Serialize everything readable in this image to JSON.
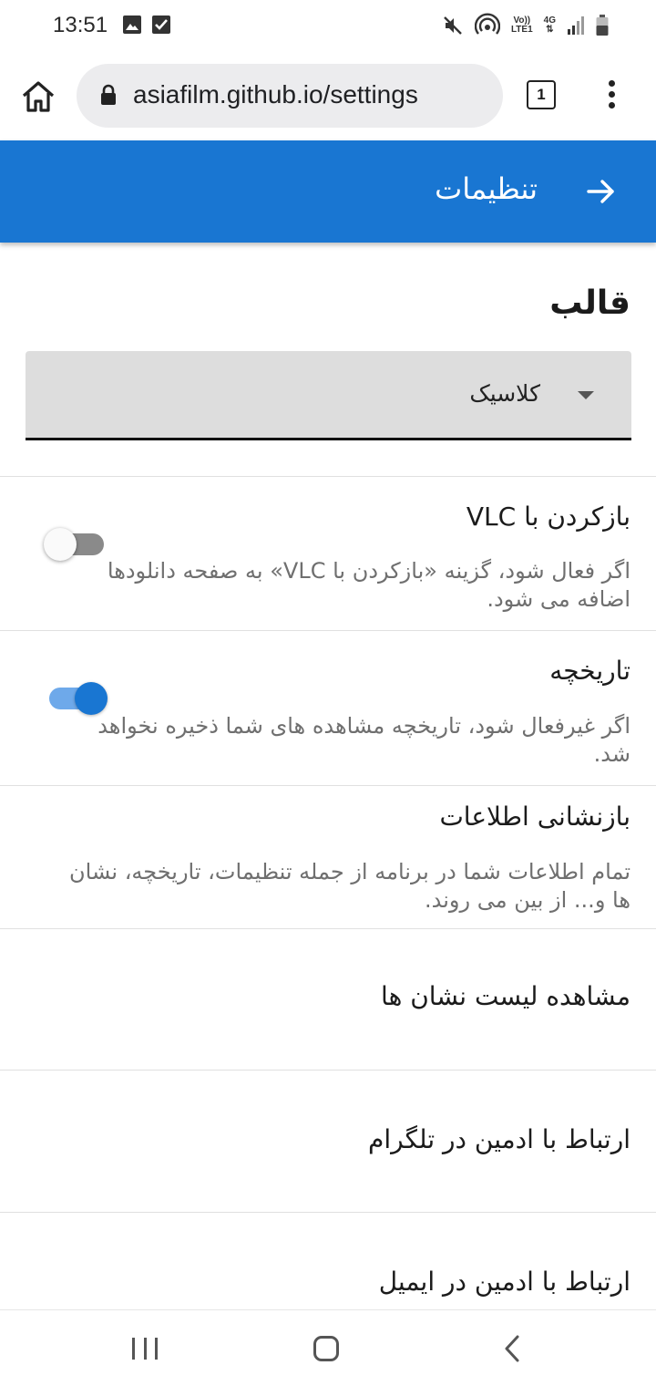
{
  "status_bar": {
    "time": "13:51",
    "volte_top": "Vo))",
    "volte_bottom": "LTE1",
    "network": "4G",
    "icons": [
      "gallery-icon",
      "check-icon",
      "mute-icon",
      "hotspot-icon",
      "volte-icon",
      "network-4g-icon",
      "signal-icon",
      "battery-icon"
    ]
  },
  "browser": {
    "url": "asiafilm.github.io/settings",
    "tab_count": "1",
    "icons": [
      "home-icon",
      "lock-icon",
      "tabs-icon",
      "more-vert-icon"
    ]
  },
  "app_bar": {
    "title": "تنظیمات",
    "background": "#1976d2",
    "icons": [
      "arrow-forward-icon"
    ]
  },
  "theme": {
    "title": "قالب",
    "selected": "کلاسیک"
  },
  "settings": {
    "vlc": {
      "title": "بازکردن با VLC",
      "description": "اگر فعال شود، گزینه «بازکردن با VLC» به صفحه دانلودها اضافه می شود.",
      "enabled": false
    },
    "history": {
      "title": "تاریخچه",
      "description": "اگر غیرفعال شود، تاریخچه مشاهده های شما ذخیره نخواهد شد.",
      "enabled": true
    },
    "reset": {
      "title": "بازنشانی اطلاعات",
      "description": "تمام اطلاعات شما در برنامه از جمله تنظیمات، تاریخچه، نشان ها و... از بین می روند."
    },
    "bookmarks": {
      "title": "مشاهده لیست نشان ها"
    },
    "telegram": {
      "title": "ارتباط با ادمین در تلگرام"
    },
    "email": {
      "title": "ارتباط با ادمین در ایمیل"
    }
  },
  "nav_bar": {
    "icons": [
      "recent-apps-icon",
      "home-nav-icon",
      "back-nav-icon"
    ]
  }
}
